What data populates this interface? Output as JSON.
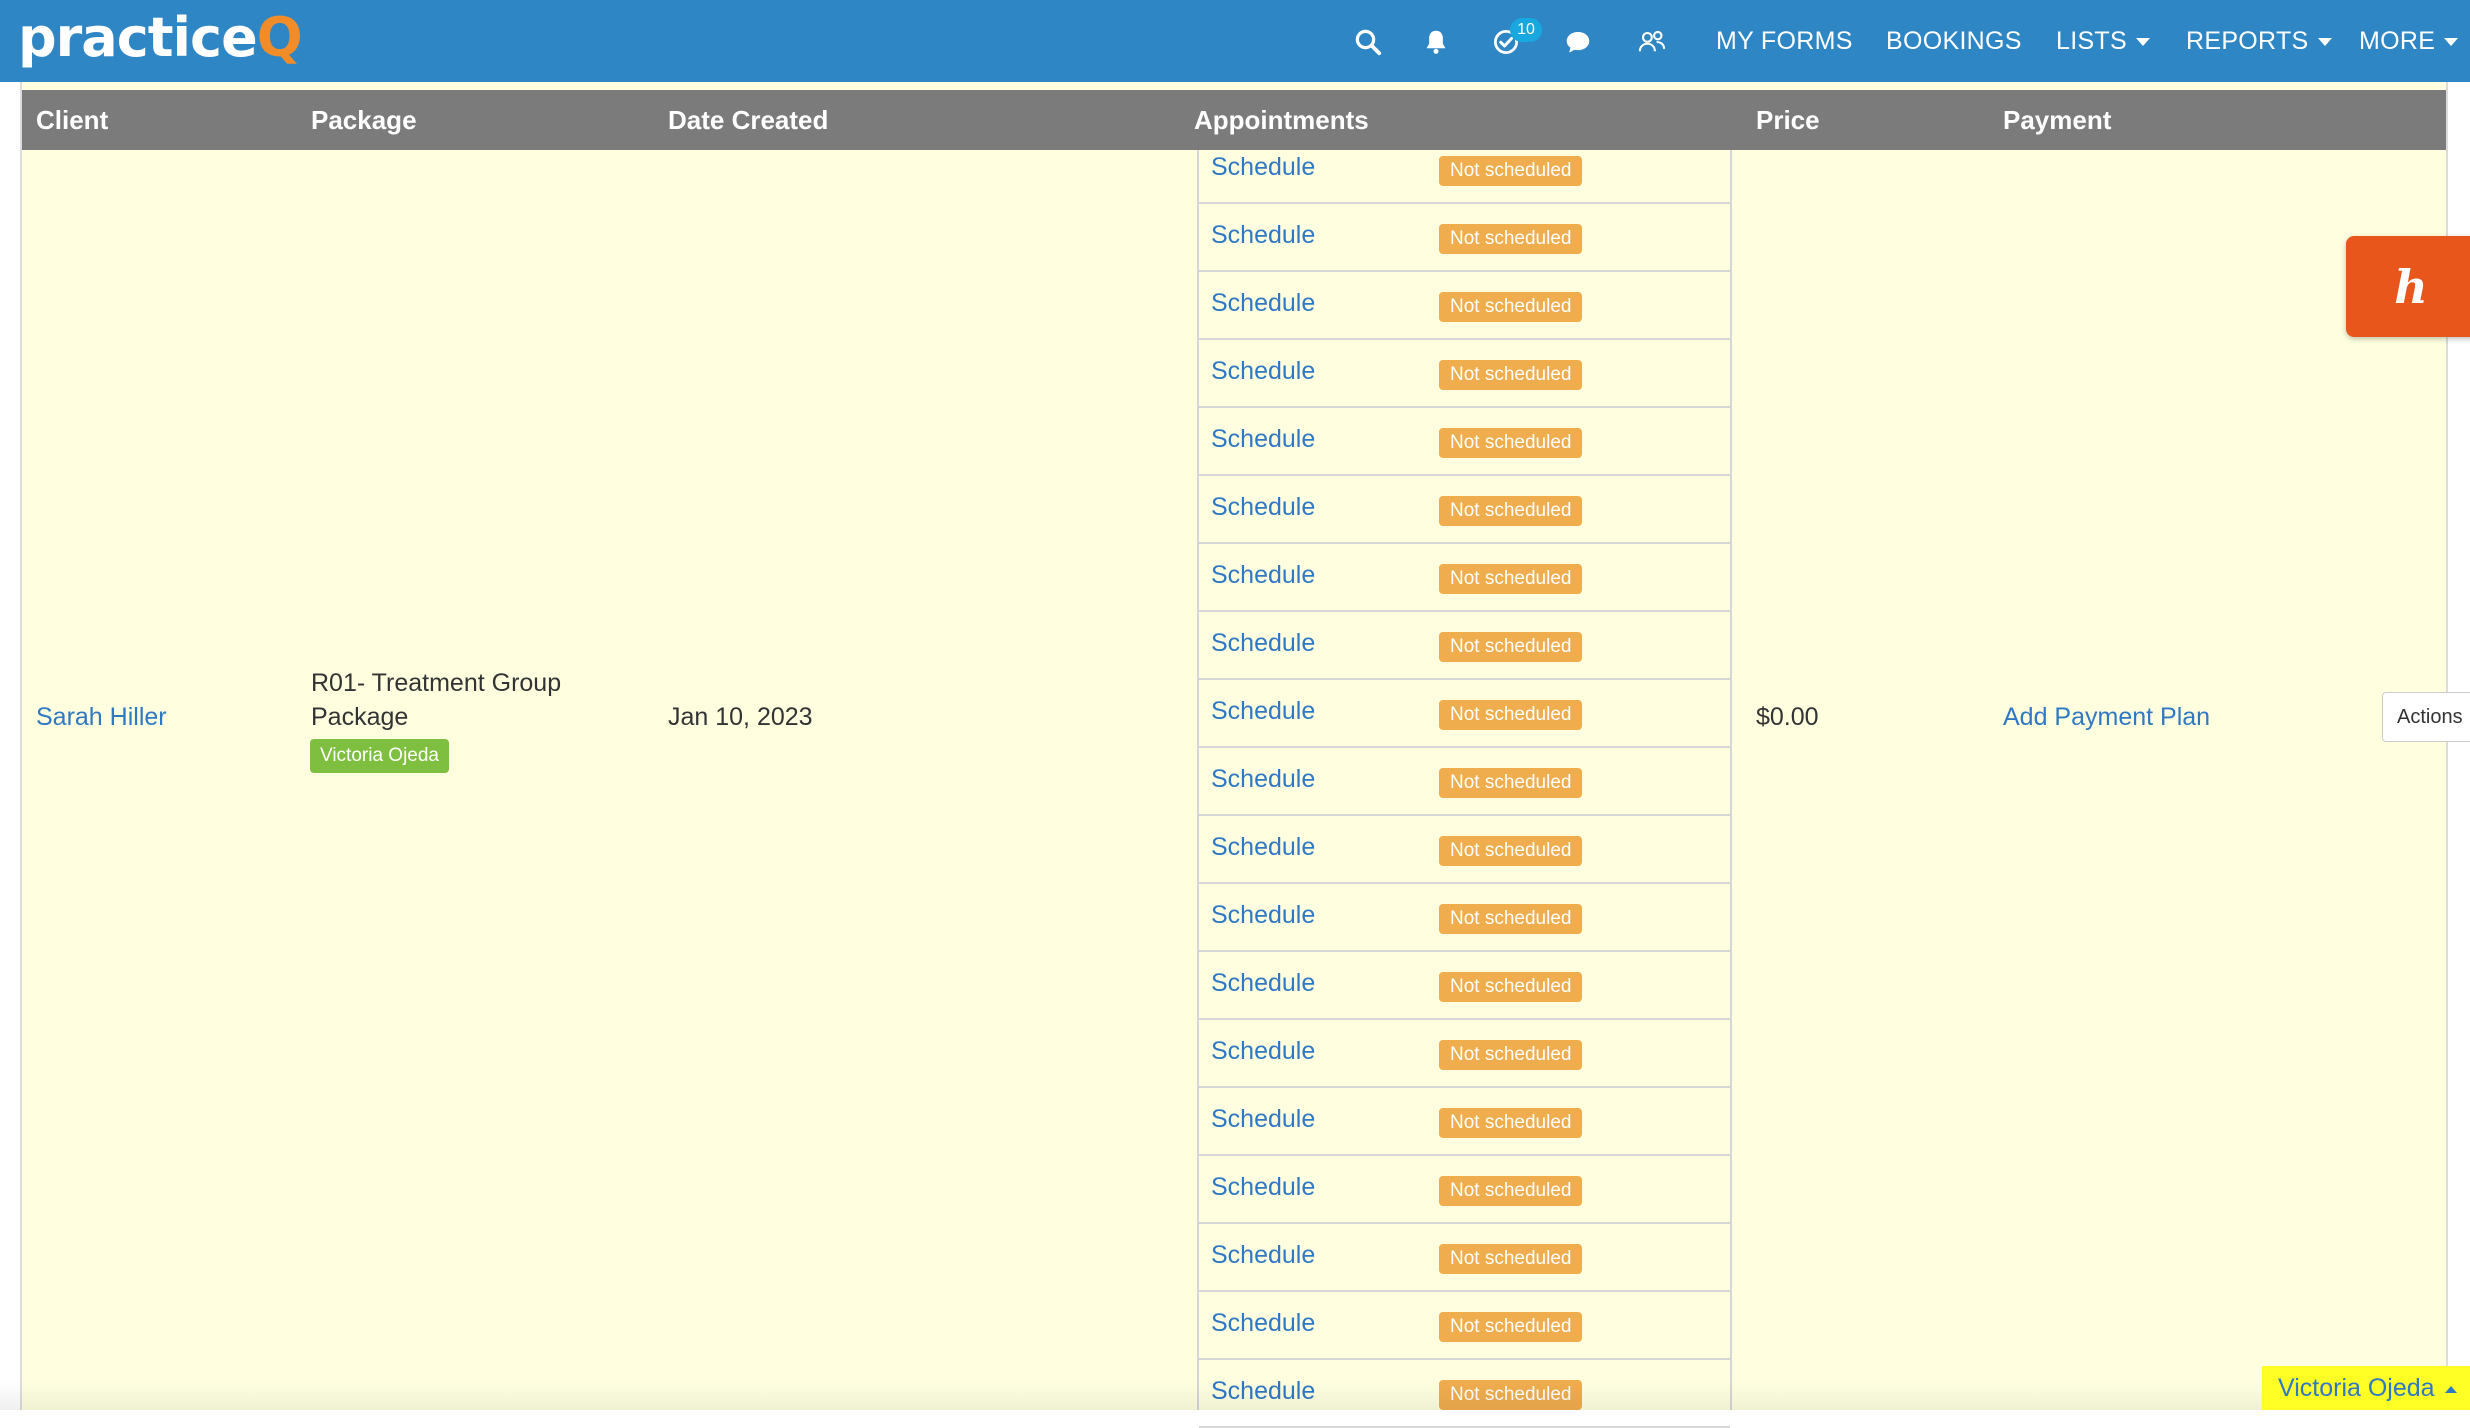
{
  "brand": {
    "name_main": "practice",
    "name_accent": "Q",
    "accent_color": "#f28c28",
    "bar_color": "#2f86c4"
  },
  "nav": {
    "icons": [
      "search-icon",
      "bell-icon",
      "tasks-check-icon",
      "chat-icon",
      "clients-icon"
    ],
    "tasks_badge": "10",
    "links": [
      {
        "label": "MY FORMS",
        "dropdown": false
      },
      {
        "label": "BOOKINGS",
        "dropdown": false
      },
      {
        "label": "LISTS",
        "dropdown": true
      },
      {
        "label": "REPORTS",
        "dropdown": true
      },
      {
        "label": "MORE",
        "dropdown": true
      }
    ]
  },
  "table": {
    "columns": [
      "Client",
      "Package",
      "Date Created",
      "Appointments",
      "Price",
      "Payment"
    ],
    "row": {
      "client": "Sarah Hiller",
      "package_line1": "R01- Treatment Group",
      "package_line2": "Package",
      "package_tag": "Victoria Ojeda",
      "date_created": "Jan 10, 2023",
      "price": "$0.00",
      "payment_link": "Add Payment Plan",
      "actions_label": "Actions"
    },
    "appointments": [
      {
        "action": "Schedule",
        "status": "Not scheduled"
      },
      {
        "action": "Schedule",
        "status": "Not scheduled"
      },
      {
        "action": "Schedule",
        "status": "Not scheduled"
      },
      {
        "action": "Schedule",
        "status": "Not scheduled"
      },
      {
        "action": "Schedule",
        "status": "Not scheduled"
      },
      {
        "action": "Schedule",
        "status": "Not scheduled"
      },
      {
        "action": "Schedule",
        "status": "Not scheduled"
      },
      {
        "action": "Schedule",
        "status": "Not scheduled"
      },
      {
        "action": "Schedule",
        "status": "Not scheduled"
      },
      {
        "action": "Schedule",
        "status": "Not scheduled"
      },
      {
        "action": "Schedule",
        "status": "Not scheduled"
      },
      {
        "action": "Schedule",
        "status": "Not scheduled"
      },
      {
        "action": "Schedule",
        "status": "Not scheduled"
      },
      {
        "action": "Schedule",
        "status": "Not scheduled"
      },
      {
        "action": "Schedule",
        "status": "Not scheduled"
      },
      {
        "action": "Schedule",
        "status": "Not scheduled"
      },
      {
        "action": "Schedule",
        "status": "Not scheduled"
      },
      {
        "action": "Schedule",
        "status": "Not scheduled"
      },
      {
        "action": "Schedule",
        "status": "Not scheduled"
      }
    ]
  },
  "help_widget_letter": "h",
  "current_user": "Victoria Ojeda"
}
